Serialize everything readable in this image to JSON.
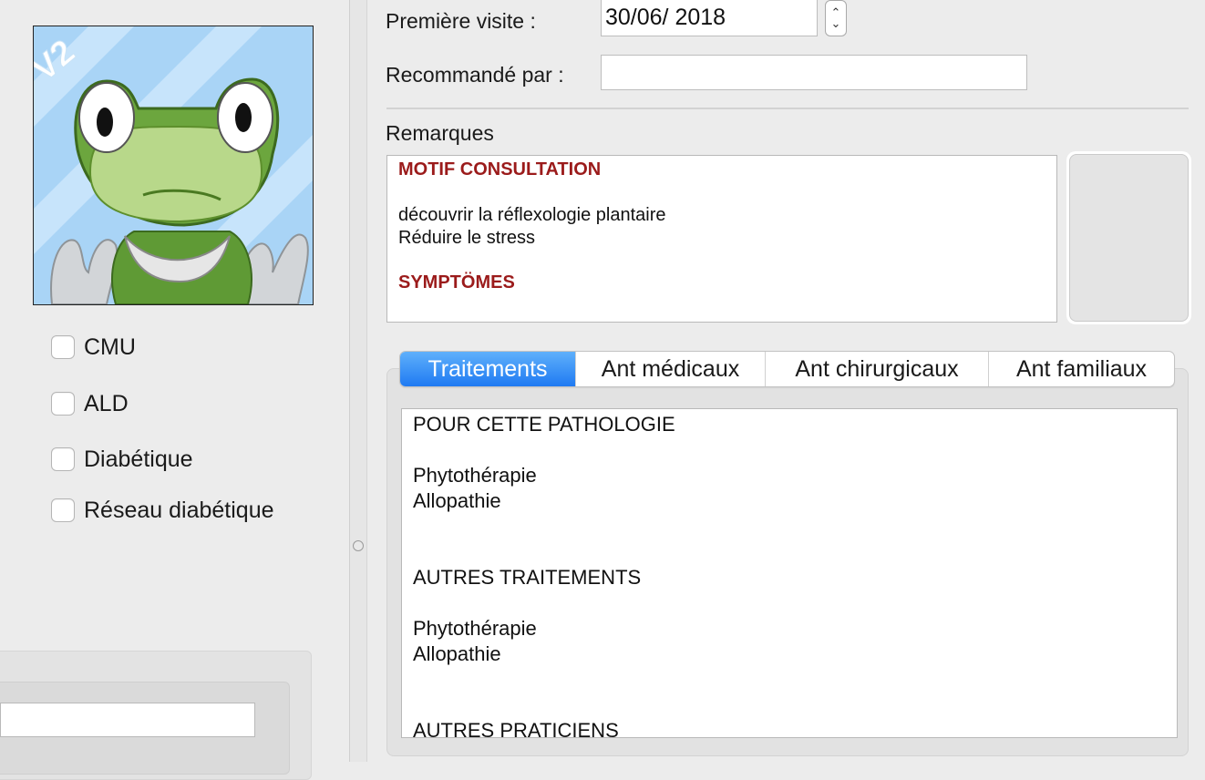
{
  "patient_flags": [
    {
      "label": "CMU",
      "checked": false
    },
    {
      "label": "ALD",
      "checked": false
    },
    {
      "label": "Diabétique",
      "checked": false
    },
    {
      "label": "Réseau diabétique",
      "checked": false
    }
  ],
  "form": {
    "first_visit_label": "Première visite :",
    "first_visit_value": "30/06/ 2018",
    "recommended_label": "Recommandé par :",
    "recommended_value": ""
  },
  "remarks": {
    "label": "Remarques",
    "lines": [
      {
        "text": "MOTIF CONSULTATION",
        "heading": true
      },
      {
        "text": "découvrir la réflexologie plantaire",
        "heading": false
      },
      {
        "text": "Réduire le stress",
        "heading": false
      },
      {
        "text": "SYMPTÖMES",
        "heading": true
      },
      {
        "text": "",
        "heading": false
      }
    ]
  },
  "tabs": [
    {
      "label": "Traitements",
      "active": true
    },
    {
      "label": "Ant médicaux",
      "active": false
    },
    {
      "label": "Ant chirurgicaux",
      "active": false
    },
    {
      "label": "Ant familiaux",
      "active": false
    }
  ],
  "treatments": {
    "lines": [
      "POUR CETTE PATHOLOGIE",
      "Phytothérapie",
      "Allopathie",
      "AUTRES TRAITEMENTS",
      "Phytothérapie",
      "Allopathie",
      "AUTRES PRATICIENS"
    ]
  },
  "avatar": {
    "badge": "V2",
    "icon": "frog-mascot-icon"
  },
  "colors": {
    "accent_tab": "#1f7af2",
    "remark_heading": "#9b1b1b"
  }
}
